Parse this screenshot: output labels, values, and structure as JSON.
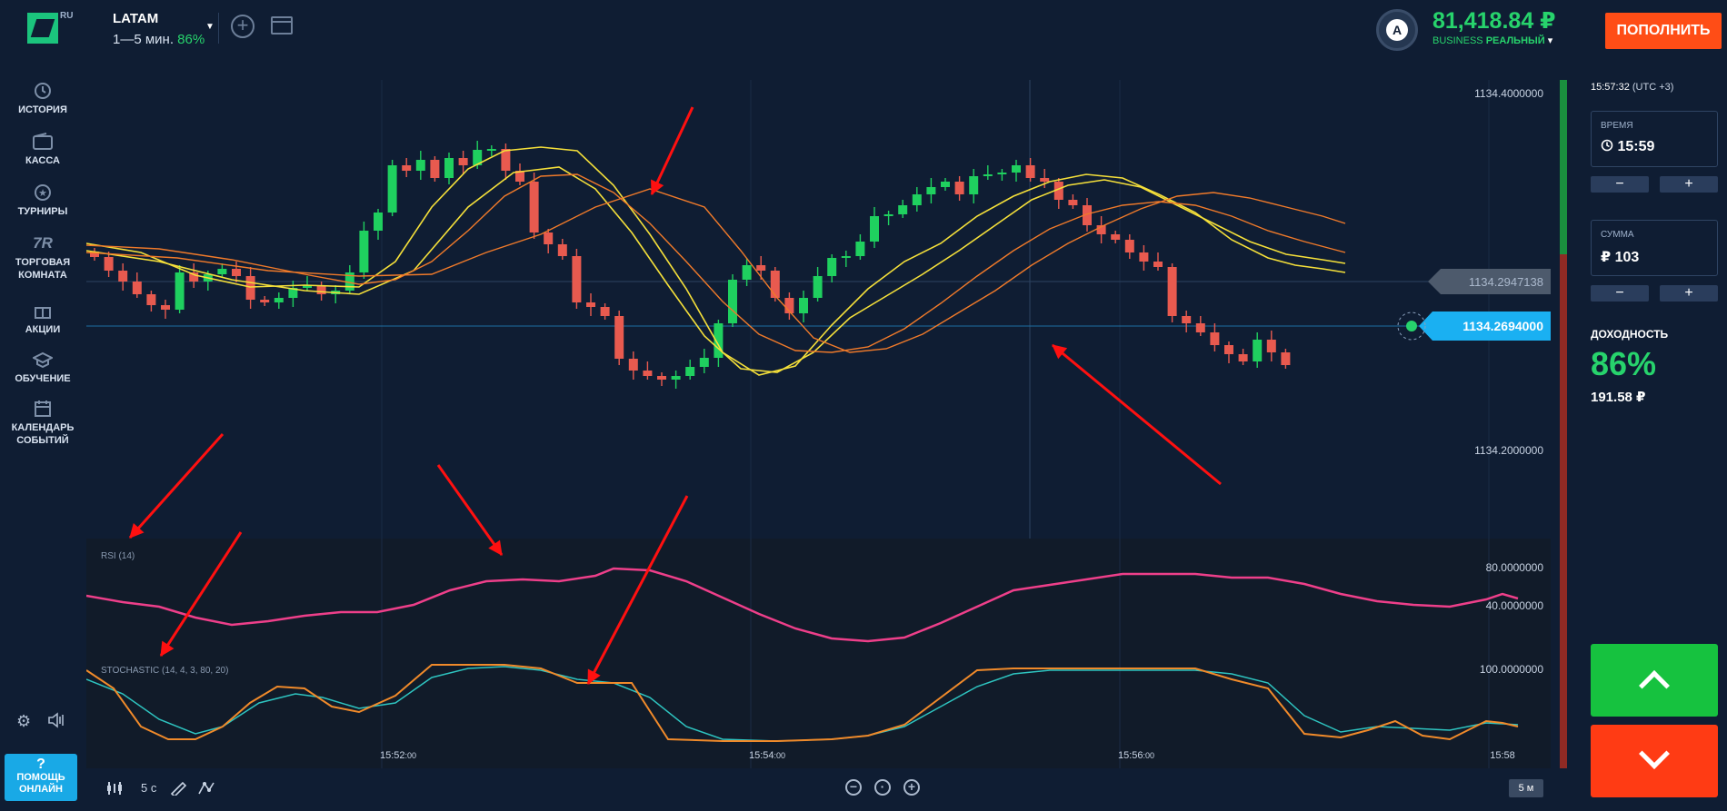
{
  "header": {
    "logo_suffix": "RU",
    "asset_name": "LATAM",
    "asset_expiry": "1—5 мин.",
    "asset_payout": "86%",
    "balance": "81,418.84 ₽",
    "account_tier": "BUSINESS",
    "account_type": "РЕАЛЬНЫЙ",
    "avatar_letter": "A",
    "deposit_label": "ПОПОЛНИТЬ"
  },
  "sidebar": {
    "items": [
      {
        "label": "ИСТОРИЯ",
        "icon": "history-icon"
      },
      {
        "label": "КАССА",
        "icon": "wallet-icon"
      },
      {
        "label": "ТУРНИРЫ",
        "icon": "star-icon"
      },
      {
        "label": "ТОРГОВАЯ",
        "label2": "КОМНАТА",
        "icon": "7r-icon",
        "icon_text": "7R"
      },
      {
        "label": "АКЦИИ",
        "icon": "gift-icon"
      },
      {
        "label": "ОБУЧЕНИЕ",
        "icon": "graduation-cap-icon"
      },
      {
        "label": "КАЛЕНДАРЬ",
        "label2": "СОБЫТИЙ",
        "icon": "calendar-icon"
      }
    ],
    "help_label1": "ПОМОЩЬ",
    "help_label2": "ОНЛАЙН",
    "help_symbol": "?"
  },
  "chart": {
    "price_labels": [
      "1134.4000000",
      "1134.2000000"
    ],
    "crosshair_price": "1134.2947138",
    "current_price": "1134.2694000",
    "rsi_label": "RSI (14)",
    "rsi_levels": [
      "80.0000000",
      "40.0000000"
    ],
    "stoch_label": "STOCHASTIC (14, 4, 3, 80, 20)",
    "stoch_level": "100.0000000",
    "time_labels": [
      {
        "main": "15:52",
        "sec": ":00"
      },
      {
        "main": "15:54",
        "sec": ":00"
      },
      {
        "main": "15:56",
        "sec": ":00"
      },
      {
        "main": "15:58",
        "sec": ""
      }
    ],
    "colors": {
      "up": "#1fd05f",
      "down": "#e85a4f",
      "ma_yellow": "#f5e03a",
      "ma_orange": "#f07a2a",
      "rsi": "#ee3f8a",
      "stoch_k": "#f08a2a",
      "stoch_d": "#2ec4c0",
      "annotation": "#ff1010"
    }
  },
  "timebar": {
    "period": "5 с",
    "interval": "5 м"
  },
  "right_panel": {
    "clock_time": "15:57:32",
    "clock_tz": "(UTC +3)",
    "time_label": "ВРЕМЯ",
    "time_value": "15:59",
    "amount_label": "СУММА",
    "amount_value": "₽ 103",
    "minus": "−",
    "plus": "+",
    "yield_label": "ДОХОДНОСТЬ",
    "yield_pct": "86%",
    "yield_amount": "191.58 ₽"
  }
}
